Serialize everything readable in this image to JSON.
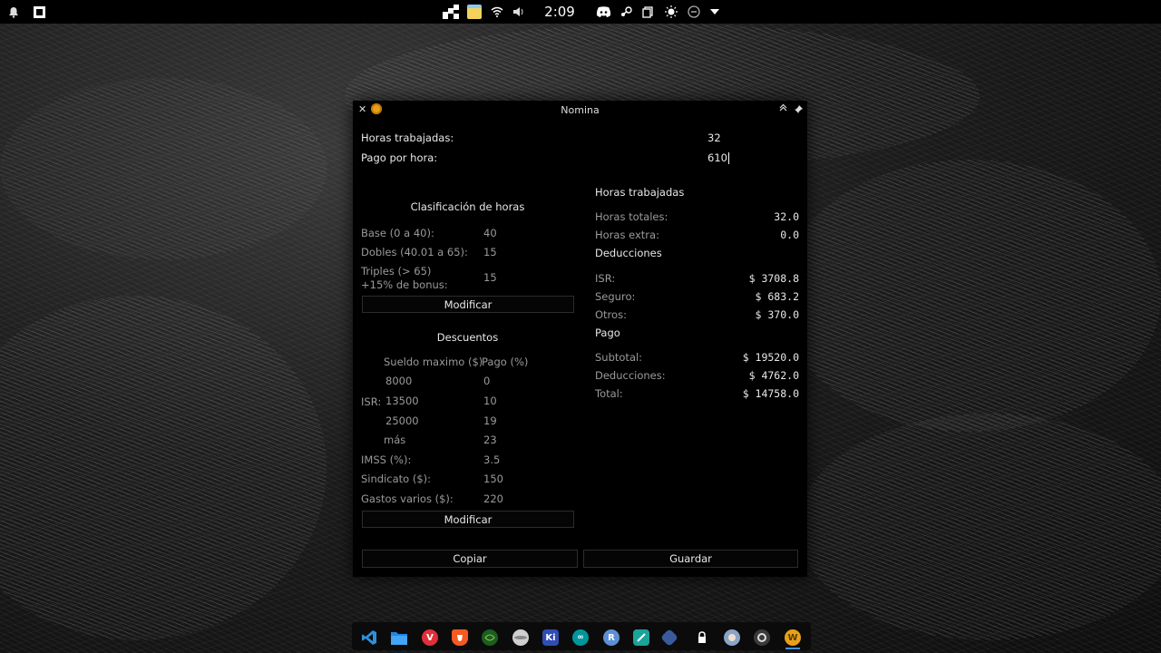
{
  "topbar": {
    "clock": "2:09"
  },
  "window": {
    "title": "Nomina",
    "inputs": {
      "horas_label": "Horas trabajadas:",
      "horas_value": "32",
      "pago_label": "Pago por hora:",
      "pago_value": "610"
    },
    "clasificacion": {
      "title": "Clasificación de horas",
      "rows": [
        {
          "label": "Base (0 a 40):",
          "value": "40"
        },
        {
          "label": "Dobles (40.01 a 65):",
          "value": "15"
        },
        {
          "label": "Triples (> 65)",
          "label2": "+15% de bonus:",
          "value": "15"
        }
      ],
      "button": "Modificar"
    },
    "descuentos": {
      "title": "Descuentos",
      "col1": "Sueldo maximo ($)",
      "col2": "Pago (%)",
      "isr_label": "ISR:",
      "isr_rows": [
        {
          "max": "8000",
          "pago": "0"
        },
        {
          "max": "13500",
          "pago": "10"
        },
        {
          "max": "25000",
          "pago": "19"
        },
        {
          "max": "más",
          "pago": "23"
        }
      ],
      "imss_label": "IMSS (%):",
      "imss_value": "3.5",
      "sindicato_label": "Sindicato ($):",
      "sindicato_value": "150",
      "gastos_label": "Gastos varios ($):",
      "gastos_value": "220",
      "button": "Modificar"
    },
    "horas": {
      "title": "Horas trabajadas",
      "totales_label": "Horas totales:",
      "totales_value": "32.0",
      "extra_label": "Horas extra:",
      "extra_value": "0.0"
    },
    "deducciones": {
      "title": "Deducciones",
      "isr_label": "ISR:",
      "isr_value": "$ 3708.8",
      "seguro_label": "Seguro:",
      "seguro_value": "$ 683.2",
      "otros_label": "Otros:",
      "otros_value": "$ 370.0"
    },
    "pago": {
      "title": "Pago",
      "subtotal_label": "Subtotal:",
      "subtotal_value": "$ 19520.0",
      "deducciones_label": "Deducciones:",
      "deducciones_value": "$ 4762.0",
      "total_label": "Total:",
      "total_value": "$ 14758.0"
    },
    "buttons": {
      "copiar": "Copiar",
      "guardar": "Guardar"
    }
  },
  "dock": {
    "icons": [
      "vscode-icon",
      "files-icon",
      "vivaldi-icon",
      "brave-icon",
      "xbox-icon",
      "disk-icon",
      "kicad-icon",
      "arduino-icon",
      "r-icon",
      "app-icon",
      "virtualbox-icon",
      "padlock-icon",
      "avatar-icon",
      "obs-icon",
      "nomina-icon"
    ]
  }
}
